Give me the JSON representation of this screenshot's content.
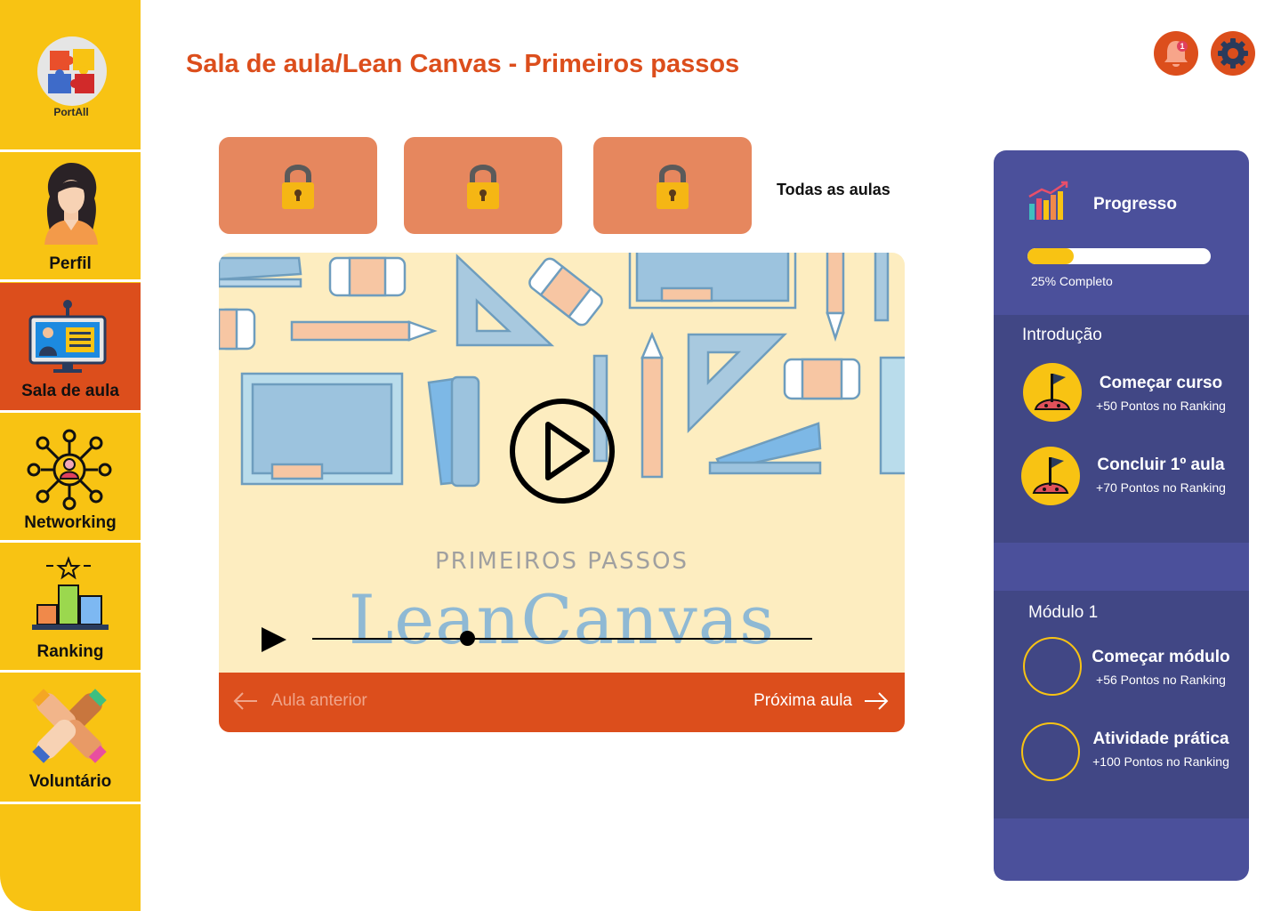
{
  "brand": {
    "name": "PortAll"
  },
  "sidebar": {
    "items": [
      {
        "label": "Perfil",
        "icon": "profile-avatar-icon",
        "active": false
      },
      {
        "label": "Sala de aula",
        "icon": "classroom-screen-icon",
        "active": true
      },
      {
        "label": "Networking",
        "icon": "network-people-icon",
        "active": false
      },
      {
        "label": "Ranking",
        "icon": "podium-icon",
        "active": false
      },
      {
        "label": "Voluntário",
        "icon": "hands-together-icon",
        "active": false
      }
    ]
  },
  "header": {
    "title": "Sala de aula/Lean Canvas - Primeiros passos",
    "notification_count": "1",
    "notification_icon": "bell-icon",
    "settings_icon": "gear-icon"
  },
  "lessons": {
    "tiles": [
      {
        "icon": "lock-icon"
      },
      {
        "icon": "lock-icon"
      },
      {
        "icon": "lock-icon"
      }
    ],
    "all_label": "Todas as aulas"
  },
  "video": {
    "subtitle": "PRIMEIROS PASSOS",
    "title": "LeanCanvas",
    "progress": 0.31
  },
  "lesson_nav": {
    "prev_label": "Aula anterior",
    "next_label": "Próxima aula"
  },
  "progress_panel": {
    "title": "Progresso",
    "percent": 25,
    "label": "25% Completo",
    "sections": [
      {
        "title": "Introdução",
        "tasks": [
          {
            "title": "Começar curso",
            "points": "+50 Pontos no Ranking",
            "done": true
          },
          {
            "title": "Concluir 1º aula",
            "points": "+70 Pontos no Ranking",
            "done": true
          }
        ]
      },
      {
        "title": "Módulo 1",
        "tasks": [
          {
            "title": "Começar módulo",
            "points": "+56 Pontos no Ranking",
            "done": false
          },
          {
            "title": "Atividade prática",
            "points": "+100 Pontos no Ranking",
            "done": false
          }
        ]
      }
    ]
  },
  "colors": {
    "sidebar": "#F8C313",
    "accent": "#DC4E1C",
    "tile": "#E6875E",
    "panel": "#4B509B",
    "panel_section": "#414785",
    "video_bg": "#FDEDC0"
  }
}
